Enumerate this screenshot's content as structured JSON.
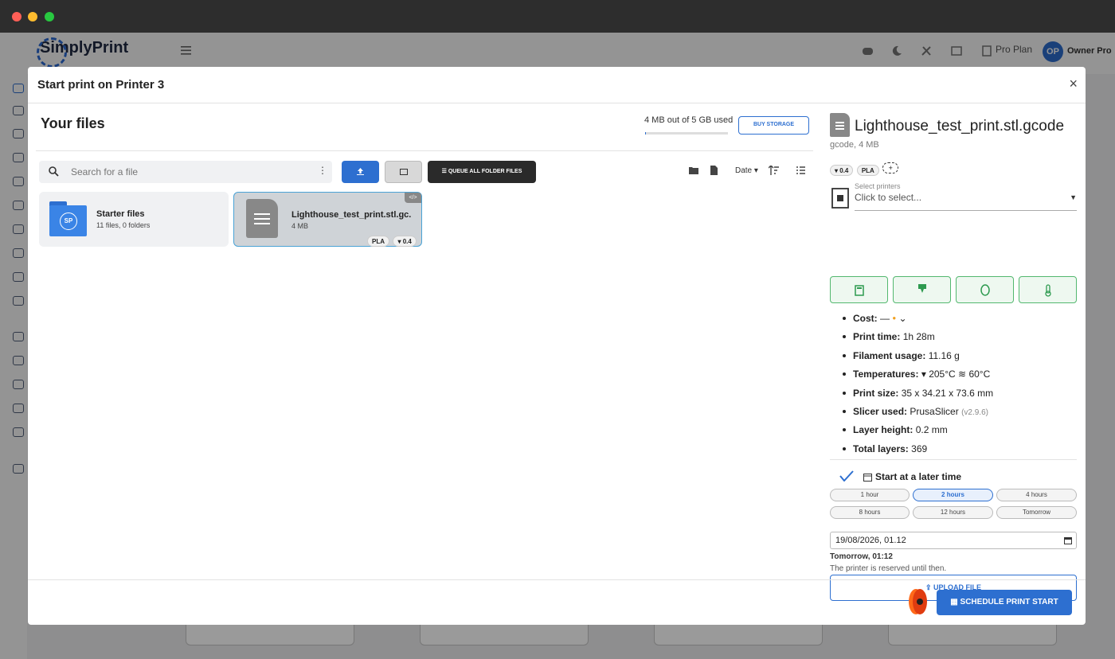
{
  "window": {
    "traffic_lights": [
      "#ff5f57",
      "#febc2e",
      "#28c840"
    ]
  },
  "app": {
    "logo": "SimplyPrint",
    "nav": {
      "pro_plan": "Pro Plan",
      "avatar_initials": "OP",
      "user_name": "Owner Pro"
    }
  },
  "modal": {
    "title": "Start print on Printer 3",
    "close": "×",
    "files": {
      "title": "Your files",
      "storage_text": "4 MB out of 5 GB used",
      "storage_used_fraction": 0.0008,
      "buy_storage": "BUY STORAGE",
      "search_placeholder": "Search for a file",
      "queue_all": "QUEUE ALL FOLDER FILES",
      "sort_label": "Date",
      "folder": {
        "name": "Starter files",
        "meta": "11 files, 0 folders",
        "badge": "SP"
      },
      "file": {
        "name": "Lighthouse_test_print.stl.gc...",
        "size": "4 MB",
        "tags": [
          "PLA",
          "0.4"
        ]
      }
    },
    "details": {
      "file_name": "Lighthouse_test_print.stl.gcode",
      "file_meta": "gcode, 4 MB",
      "tags": [
        "0.4",
        "PLA"
      ],
      "select_printers_label": "Select printers",
      "select_printers_value": "Click to select...",
      "specs": [
        {
          "label": "Cost:",
          "value": "—"
        },
        {
          "label": "Print time:",
          "value": "1h 28m"
        },
        {
          "label": "Filament usage:",
          "value": "11.16 g"
        },
        {
          "label": "Temperatures:",
          "nozzle": "205°C",
          "bed": "60°C"
        },
        {
          "label": "Print size:",
          "value": "35 x 34.21 x 73.6 mm"
        },
        {
          "label": "Slicer used:",
          "value": "PrusaSlicer",
          "extra": "(v2.9.6)"
        },
        {
          "label": "Layer height:",
          "value": "0.2 mm"
        },
        {
          "label": "Total layers:",
          "value": "369"
        }
      ],
      "later": {
        "title": "Start at a later time",
        "options": [
          "1 hour",
          "2 hours",
          "4 hours",
          "8 hours",
          "12 hours",
          "Tomorrow"
        ],
        "selected": "2 hours",
        "datetime_value": "19/08/2026, 01.12",
        "summary_strong": "Tomorrow, 01:12",
        "summary_note": "The printer is reserved until then."
      },
      "upload_file": "UPLOAD FILE"
    },
    "schedule_button": "SCHEDULE PRINT START"
  }
}
